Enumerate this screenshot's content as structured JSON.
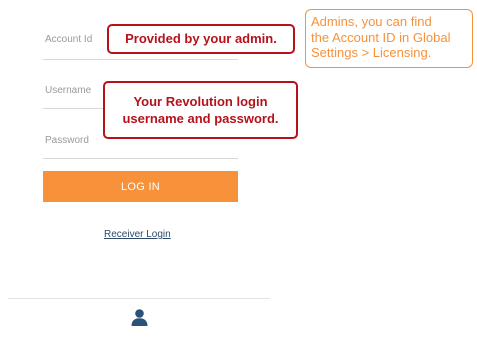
{
  "form": {
    "account_id_placeholder": "Account Id",
    "username_placeholder": "Username",
    "password_placeholder": "Password",
    "login_label": "LOG IN",
    "receiver_login_label": "Receiver Login"
  },
  "annotations": {
    "admin_callout": "Provided by your admin.",
    "login_callout": "Your Revolution login\nusername and password.",
    "licensing_note": "Admins, you can find\nthe Account ID in Global\nSettings > Licensing."
  },
  "colors": {
    "accent": "#f7923a",
    "callout_red": "#b5121b",
    "link": "#2e4a6a",
    "icon": "#2b5278"
  },
  "footer": {
    "icon": "user-icon"
  }
}
